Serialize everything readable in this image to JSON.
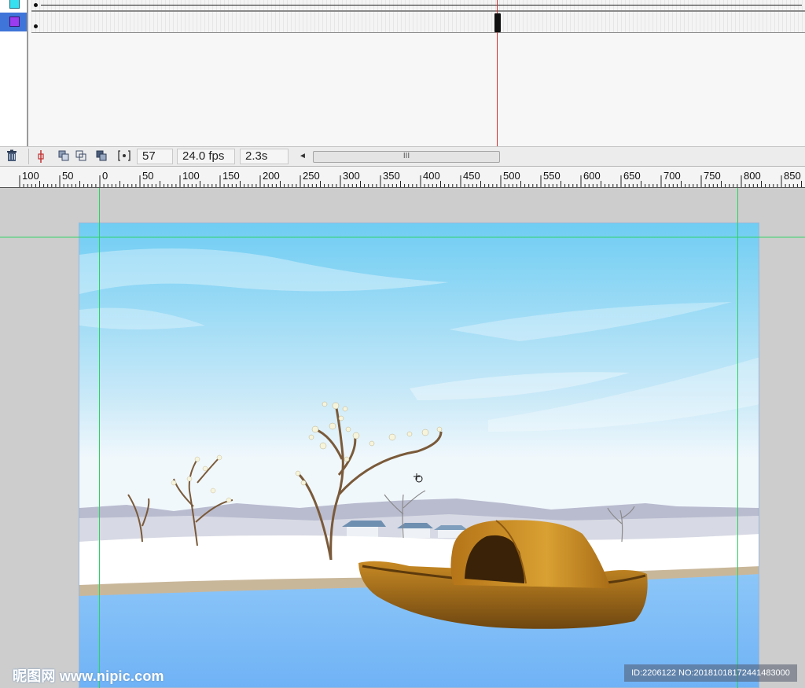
{
  "timeline": {
    "layers": [
      {
        "swatch_color": "#35e0f0"
      },
      {
        "swatch_color": "#9b3cf0",
        "selected": true
      }
    ],
    "current_frame": "57",
    "frame_rate": "24.0 fps",
    "elapsed_time": "2.3s",
    "scroll_thumb_glyph": "III",
    "scroll_left_glyph": "◄"
  },
  "ruler": {
    "labels": [
      "100",
      "50",
      "0",
      "50",
      "100",
      "150",
      "200",
      "250",
      "300",
      "350",
      "400",
      "450",
      "500",
      "550",
      "600",
      "650",
      "700",
      "750",
      "800",
      "850"
    ]
  },
  "watermark": {
    "left_text": "昵图网 www.nipic.com",
    "right_text": "ID:2206122 NO:20181018172441483000"
  },
  "colors": {
    "sky_top": "#6fcdf3",
    "sky_bottom": "#f1f8fc",
    "water": "#72b6f7",
    "boat": "#b77b18",
    "guide": "#29d45f",
    "playhead": "#d23030"
  }
}
